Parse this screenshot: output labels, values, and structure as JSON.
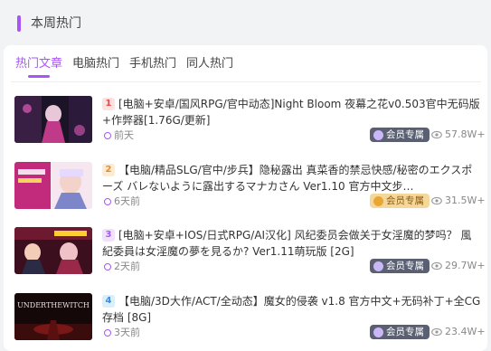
{
  "section": {
    "title": "本周热门"
  },
  "tabs": [
    {
      "label": "热门文章"
    },
    {
      "label": "电脑热门"
    },
    {
      "label": "手机热门"
    },
    {
      "label": "同人热门"
    }
  ],
  "items": [
    {
      "rank": "1",
      "title": "[电脑+安卓/国风RPG/官中动态]Night Bloom 夜幕之花v0.503官中无码版+作弊器[1.76G/更新]",
      "time": "前天",
      "badge": "会员专属",
      "views": "57.8W+",
      "thumb_icon": "game-cover-thumbnail"
    },
    {
      "rank": "2",
      "title": "【电脑/精品SLG/官中/步兵】隐秘露出 真菜香的禁忌快感/秘密のエクスポーズ バレないように露出するマナカさん Ver1.10 官方中文步…",
      "time": "6天前",
      "badge": "会员专属",
      "views": "31.5W+",
      "thumb_icon": "game-cover-thumbnail"
    },
    {
      "rank": "3",
      "title": "[电脑+安卓+IOS/日式RPG/AI汉化] 风纪委员会做关于女淫魔的梦吗？ 風紀委員は女淫魔の夢を見るか? Ver1.11萌玩版 [2G]",
      "time": "2天前",
      "badge": "会员专属",
      "views": "29.7W+",
      "thumb_icon": "game-cover-thumbnail"
    },
    {
      "rank": "4",
      "title": "【电脑/3D大作/ACT/全动态】魔女的侵袭 v1.8 官方中文+无码补丁+全CG存档 [8G]",
      "time": "3天前",
      "badge": "会员专属",
      "views": "23.4W+",
      "thumb_icon": "game-cover-thumbnail",
      "thumb_text": "UNDERTHEWITCH"
    }
  ],
  "colors": {
    "accent": "#a855f7",
    "badge_member": "#5a6072",
    "badge_gold": "#f6d79a"
  }
}
